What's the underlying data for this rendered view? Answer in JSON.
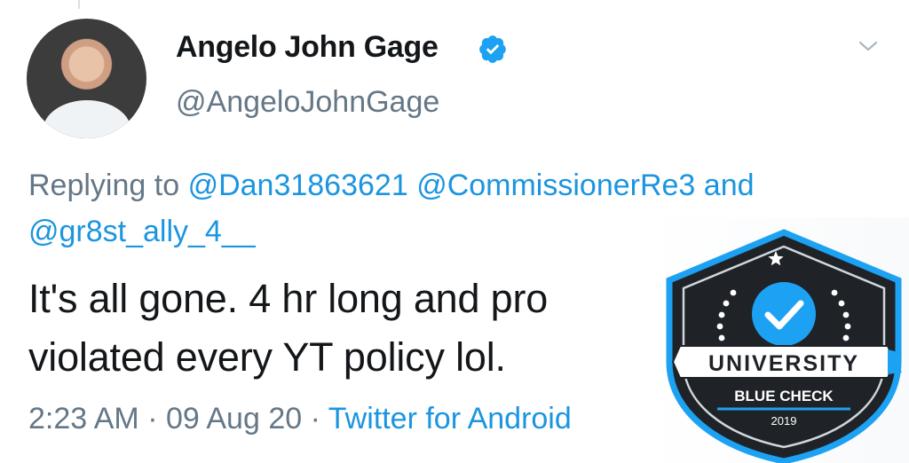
{
  "tweet": {
    "display_name": "Angelo John Gage",
    "handle": "@AngeloJohnGage",
    "reply_prefix": "Replying to",
    "mentions": [
      "@Dan31863621",
      "@CommissionerRe3",
      "and",
      "@gr8st_ally_4__"
    ],
    "text_line1": "It's all gone. 4 hr long and pro",
    "text_line2": "violated every YT policy lol.",
    "time": "2:23 AM",
    "date": "09 Aug 20",
    "separator": "·",
    "source": "Twitter for Android"
  },
  "badge": {
    "line1": "UNIVERSITY",
    "line2": "BLUE CHECK",
    "year": "2019"
  },
  "colors": {
    "text": "#14171a",
    "muted": "#657786",
    "link": "#1b95e0",
    "badge_blue": "#1da1f2",
    "badge_dark": "#1f2328"
  },
  "icons": [
    "verified-icon",
    "chevron-down-icon",
    "check-icon"
  ]
}
